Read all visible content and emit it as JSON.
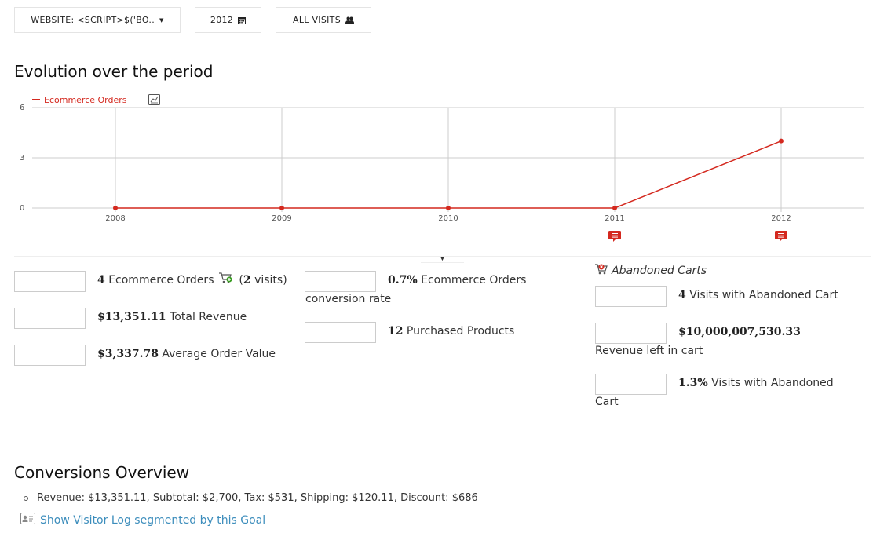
{
  "toolbar": {
    "website_label": "WEBSITE: <SCRIPT>$('BO..",
    "period_label": "2012",
    "segment_label": "ALL VISITS"
  },
  "evolution": {
    "title": "Evolution over the period"
  },
  "chart_data": {
    "type": "line",
    "x": [
      "2008",
      "2009",
      "2010",
      "2011",
      "2012"
    ],
    "series": [
      {
        "name": "Ecommerce Orders",
        "values": [
          0,
          0,
          0,
          0,
          4
        ],
        "color": "#d4291f"
      }
    ],
    "yticks": [
      "0",
      "3",
      "6"
    ],
    "ylim": [
      0,
      6
    ],
    "grid": true,
    "legend": "top-left",
    "annotations_on": [
      "2011",
      "2012"
    ]
  },
  "metrics_left": [
    {
      "number": "4",
      "label": " Ecommerce Orders",
      "suffix_num": "2",
      "suffix_label": " visits)"
    },
    {
      "number": "$13,351.11",
      "label": " Total Revenue"
    },
    {
      "number": "$3,337.78",
      "label": " Average Order Value"
    }
  ],
  "metrics_middle": [
    {
      "number": "0.7%",
      "label": " Ecommerce Orders",
      "label2": "conversion rate"
    },
    {
      "number": "12",
      "label": " Purchased Products"
    }
  ],
  "abandoned": {
    "title": "Abandoned Carts",
    "metrics": [
      {
        "number": "4",
        "label": " Visits with Abandoned Cart"
      },
      {
        "number": "$10,000,007,530.33",
        "label2": "Revenue left in cart"
      },
      {
        "number": "1.3%",
        "label": " Visits with Abandoned",
        "label2": "Cart"
      }
    ]
  },
  "conversions": {
    "title": "Conversions Overview",
    "line": "Revenue: $13,351.11, Subtotal: $2,700, Tax: $531, Shipping: $120.11, Discount: $686",
    "visitor_log_link": "Show Visitor Log segmented by this Goal"
  }
}
